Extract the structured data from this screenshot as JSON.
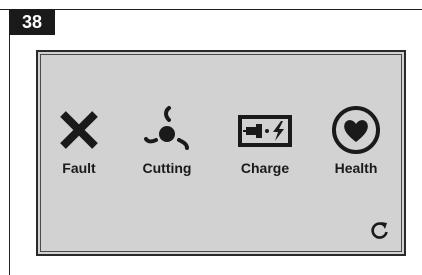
{
  "step_number": "38",
  "status_items": [
    {
      "label": "Fault",
      "icon": "x-cross-icon"
    },
    {
      "label": "Cutting",
      "icon": "cutting-blades-icon"
    },
    {
      "label": "Charge",
      "icon": "battery-charge-icon"
    },
    {
      "label": "Health",
      "icon": "heart-icon"
    }
  ],
  "refresh_icon": "refresh-icon",
  "colors": {
    "display_background": "#d2d2d2",
    "ink": "#1a1a1a",
    "badge_background": "#1a1a1a"
  }
}
